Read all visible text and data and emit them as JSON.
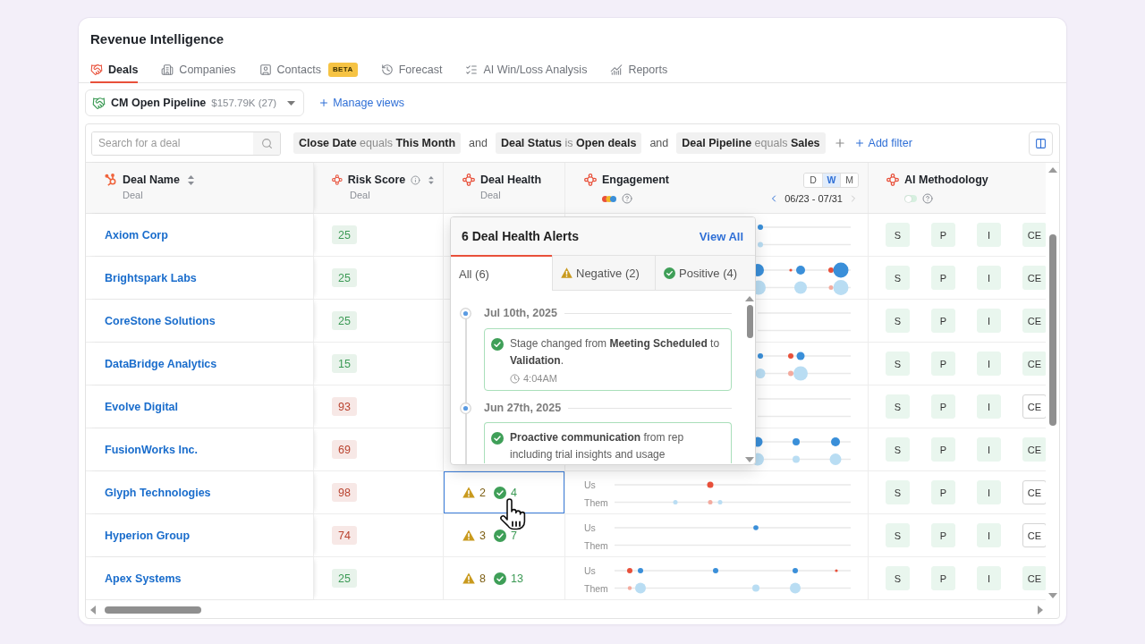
{
  "page": {
    "title": "Revenue Intelligence"
  },
  "tabs": [
    {
      "label": "Deals",
      "kind": "deals",
      "selected": true
    },
    {
      "label": "Companies",
      "kind": "companies",
      "selected": false
    },
    {
      "label": "Contacts",
      "kind": "contacts",
      "selected": false,
      "badge": "BETA"
    },
    {
      "label": "Forecast",
      "kind": "forecast",
      "selected": false
    },
    {
      "label": "AI Win/Loss Analysis",
      "kind": "winloss",
      "selected": false
    },
    {
      "label": "Reports",
      "kind": "reports",
      "selected": false
    }
  ],
  "view_selector": {
    "name": "CM Open Pipeline",
    "summary": "$157.79K (27)",
    "manage_label": "Manage views"
  },
  "filter_bar": {
    "search_placeholder": "Search for a deal",
    "conditions": [
      {
        "field": "Close Date",
        "operator": "equals",
        "value": "This Month"
      },
      {
        "joiner": "and",
        "field": "Deal Status",
        "operator": "is",
        "value": "Open deals"
      },
      {
        "joiner": "and",
        "field": "Deal Pipeline",
        "operator": "equals",
        "value": "Sales"
      }
    ],
    "add_filter": "Add filter"
  },
  "table": {
    "columns": [
      {
        "kind": "name",
        "title": "Deal Name",
        "subtitle": "Deal",
        "sortable": true,
        "info": false
      },
      {
        "kind": "risk",
        "title": "Risk Score",
        "subtitle": "Deal",
        "sortable": true,
        "info": true
      },
      {
        "kind": "health",
        "title": "Deal Health",
        "subtitle": "Deal",
        "sortable": false,
        "info": false
      },
      {
        "kind": "engagement",
        "title": "Engagement",
        "sortable": false,
        "info": false,
        "granularity": [
          {
            "label": "D",
            "selected": false
          },
          {
            "label": "W",
            "selected": true
          },
          {
            "label": "M",
            "selected": false
          }
        ],
        "range": "06/23 - 07/31",
        "next_disabled": true
      },
      {
        "kind": "methodology",
        "title": "AI Methodology",
        "sortable": false,
        "info": false,
        "toggle_on": false
      }
    ],
    "rows": [
      {
        "name": "Axiom Corp",
        "risk": "25",
        "color": "#3c9a55",
        "methodology": [
          {
            "label": "S",
            "met": true
          },
          {
            "label": "P",
            "met": true
          },
          {
            "label": "I",
            "met": true
          },
          {
            "label": "CE",
            "met": true
          }
        ]
      },
      {
        "name": "Brightspark Labs",
        "risk": "25",
        "color": "#3c9a55",
        "methodology": [
          {
            "label": "S",
            "met": true
          },
          {
            "label": "P",
            "met": true
          },
          {
            "label": "I",
            "met": true
          },
          {
            "label": "CE",
            "met": true
          }
        ]
      },
      {
        "name": "CoreStone Solutions",
        "risk": "25",
        "color": "#3c9a55",
        "methodology": [
          {
            "label": "S",
            "met": true
          },
          {
            "label": "P",
            "met": true
          },
          {
            "label": "I",
            "met": true
          },
          {
            "label": "CE",
            "met": true
          }
        ]
      },
      {
        "name": "DataBridge Analytics",
        "risk": "15",
        "color": "#3c9a55",
        "methodology": [
          {
            "label": "S",
            "met": true
          },
          {
            "label": "P",
            "met": true
          },
          {
            "label": "I",
            "met": true
          },
          {
            "label": "CE",
            "met": true
          }
        ]
      },
      {
        "name": "Evolve Digital",
        "risk": "93",
        "color": "#b9432f",
        "methodology": [
          {
            "label": "S",
            "met": true
          },
          {
            "label": "P",
            "met": true
          },
          {
            "label": "I",
            "met": true
          },
          {
            "label": "CE",
            "met": false
          }
        ]
      },
      {
        "name": "FusionWorks Inc.",
        "risk": "69",
        "color": "#b9432f",
        "methodology": [
          {
            "label": "S",
            "met": true
          },
          {
            "label": "P",
            "met": true
          },
          {
            "label": "I",
            "met": true
          },
          {
            "label": "CE",
            "met": true
          }
        ]
      },
      {
        "name": "Glyph Technologies",
        "risk": "98",
        "color": "#b9432f",
        "health": {
          "warnings": "2",
          "positives": "4",
          "selected": true
        },
        "engagement": {
          "us": "Us",
          "them": "Them"
        },
        "methodology": [
          {
            "label": "S",
            "met": true
          },
          {
            "label": "P",
            "met": true
          },
          {
            "label": "I",
            "met": true
          },
          {
            "label": "CE",
            "met": false
          }
        ]
      },
      {
        "name": "Hyperion Group",
        "risk": "74",
        "color": "#b9432f",
        "health": {
          "warnings": "3",
          "positives": "7",
          "selected": false
        },
        "engagement": {
          "us": "Us",
          "them": "Them"
        },
        "methodology": [
          {
            "label": "S",
            "met": true
          },
          {
            "label": "P",
            "met": true
          },
          {
            "label": "I",
            "met": true
          },
          {
            "label": "CE",
            "met": false
          }
        ]
      },
      {
        "name": "Apex Systems",
        "risk": "25",
        "color": "#3c9a55",
        "health": {
          "warnings": "8",
          "positives": "13",
          "selected": false
        },
        "engagement": {
          "us": "Us",
          "them": "Them"
        },
        "methodology": [
          {
            "label": "S",
            "met": true
          },
          {
            "label": "P",
            "met": true
          },
          {
            "label": "I",
            "met": true
          },
          {
            "label": "CE",
            "met": true
          }
        ]
      }
    ]
  },
  "alerts_popup": {
    "title": "6 Deal Health Alerts",
    "view_all": "View All",
    "tabs": [
      {
        "label": "All (6)",
        "kind": "all",
        "selected": true
      },
      {
        "label": "Negative (2)",
        "kind": "negative",
        "selected": false
      },
      {
        "label": "Positive (4)",
        "kind": "positive",
        "selected": false
      }
    ],
    "groups": [
      {
        "date": "Jul 10th, 2025",
        "alerts": [
          {
            "kind": "positive",
            "text": "Stage changed from **Meeting Scheduled** to **Validation**.",
            "time": "4:04AM"
          }
        ]
      },
      {
        "date": "Jun 27th, 2025",
        "alerts": [
          {
            "kind": "positive",
            "text": "**Proactive communication** from rep including trial insights and usage"
          }
        ]
      }
    ]
  }
}
